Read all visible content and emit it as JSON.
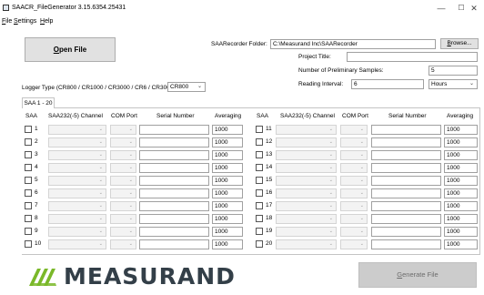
{
  "window": {
    "title": "SAACR_FileGenerator 3.15.6354.25431",
    "minimize_glyph": "—",
    "maximize_glyph": "☐",
    "close_glyph": "✕"
  },
  "menu": [
    {
      "label_ul": "F",
      "label_rest": "ile"
    },
    {
      "label_ul": "S",
      "label_rest": "ettings"
    },
    {
      "label_ul": "H",
      "label_rest": "elp"
    }
  ],
  "open_file": {
    "label_ul": "O",
    "label_rest": "pen File"
  },
  "recorder": {
    "folder_label": "SAARecorder Folder:",
    "folder_value": "C:\\Measurand Inc\\SAARecorder",
    "browse_ul": "B",
    "browse_rest": "rowse..."
  },
  "project": {
    "title_label": "Project Title:",
    "title_value": ""
  },
  "samples": {
    "label": "Number of Preliminary Samples:",
    "value": "5"
  },
  "interval": {
    "label": "Reading Interval:",
    "value": "6",
    "unit": "Hours"
  },
  "logger": {
    "label": "Logger Type (CR800 / CR1000 / CR3000 / CR6 / CR300):",
    "value": "CR800"
  },
  "tab": {
    "label": "SAA 1 - 20"
  },
  "columns": {
    "saa": "SAA",
    "channel": "SAA232(-5) Channel",
    "com": "COM Port",
    "serial": "Serial Number",
    "averaging": "Averaging"
  },
  "rows_left": [
    {
      "n": "1",
      "avg": "1000"
    },
    {
      "n": "2",
      "avg": "1000"
    },
    {
      "n": "3",
      "avg": "1000"
    },
    {
      "n": "4",
      "avg": "1000"
    },
    {
      "n": "5",
      "avg": "1000"
    },
    {
      "n": "6",
      "avg": "1000"
    },
    {
      "n": "7",
      "avg": "1000"
    },
    {
      "n": "8",
      "avg": "1000"
    },
    {
      "n": "9",
      "avg": "1000"
    },
    {
      "n": "10",
      "avg": "1000"
    }
  ],
  "rows_right": [
    {
      "n": "11",
      "avg": "1000"
    },
    {
      "n": "12",
      "avg": "1000"
    },
    {
      "n": "13",
      "avg": "1000"
    },
    {
      "n": "14",
      "avg": "1000"
    },
    {
      "n": "15",
      "avg": "1000"
    },
    {
      "n": "16",
      "avg": "1000"
    },
    {
      "n": "17",
      "avg": "1000"
    },
    {
      "n": "18",
      "avg": "1000"
    },
    {
      "n": "19",
      "avg": "1000"
    },
    {
      "n": "20",
      "avg": "1000"
    }
  ],
  "logo": {
    "text": "MEASURAND",
    "color": "#333f48",
    "mark_color": "#7ab829"
  },
  "generate": {
    "label_ul": "G",
    "label_rest": "enerate File",
    "enabled": false
  },
  "dropdown_arrow": "⌄"
}
